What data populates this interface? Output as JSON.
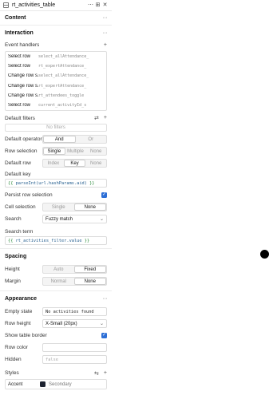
{
  "header": {
    "title": "rt_activities_table"
  },
  "sections": {
    "content": "Content",
    "interaction": "Interaction",
    "spacing": "Spacing",
    "appearance": "Appearance"
  },
  "event_handlers": {
    "label": "Event handlers",
    "rows": [
      {
        "event": "Select row",
        "action": "select_allAttendance_"
      },
      {
        "event": "Select row",
        "action": "rt_expertAttendance_"
      },
      {
        "event": "Change row s...",
        "action": "select_allAttendance_"
      },
      {
        "event": "Change row s...",
        "action": "rt_expertAttendance_"
      },
      {
        "event": "Change row s...",
        "action": "rt_attendees_toggle"
      },
      {
        "event": "Select row",
        "action": "current_activityId_s"
      }
    ]
  },
  "default_filters": {
    "label": "Default filters",
    "empty": "No filters"
  },
  "default_operator": {
    "label": "Default operator",
    "options": [
      "And",
      "Or"
    ],
    "selected": "And"
  },
  "row_selection": {
    "label": "Row selection",
    "options": [
      "Single",
      "Multiple",
      "None"
    ],
    "selected": "Single"
  },
  "default_row": {
    "label": "Default row",
    "options": [
      "Index",
      "Key",
      "None"
    ],
    "selected": "Key"
  },
  "default_key": {
    "label": "Default key",
    "open": "{{",
    "expr": "parseInt(url.hashParams.aid)",
    "close": "}}"
  },
  "persist_row_selection": {
    "label": "Persist row selection",
    "checked": true
  },
  "cell_selection": {
    "label": "Cell selection",
    "options": [
      "Single",
      "None"
    ],
    "selected": "None"
  },
  "search": {
    "label": "Search",
    "value": "Fuzzy match"
  },
  "search_term": {
    "label": "Search term",
    "open": "{{",
    "expr": "rt_activities_filter.value",
    "close": "}}"
  },
  "height": {
    "label": "Height",
    "options": [
      "Auto",
      "Fixed"
    ],
    "selected": "Fixed"
  },
  "margin": {
    "label": "Margin",
    "options": [
      "Normal",
      "None"
    ],
    "selected": "None"
  },
  "empty_state": {
    "label": "Empty state",
    "value": "No activities found"
  },
  "row_height": {
    "label": "Row height",
    "value": "X-Small (20px)"
  },
  "show_table_border": {
    "label": "Show table border",
    "checked": true
  },
  "row_color": {
    "label": "Row color",
    "value": ""
  },
  "hidden": {
    "label": "Hidden",
    "value": "false"
  },
  "styles": {
    "label": "Styles",
    "accent_label": "Accent",
    "accent_value": "Secondary",
    "accent_color": "#1c2230"
  },
  "colors": {
    "checkbox": "#2d6fd6"
  },
  "icons": {
    "component": "component-icon",
    "more": "more-horizontal-icon",
    "pin": "pin-icon",
    "close": "close-icon",
    "filter_link": "link-icon",
    "add": "plus-icon",
    "chevron": "chevron-down-icon",
    "reset": "reset-icon",
    "check": "checkmark-icon",
    "cursor": "cursor-dot-icon"
  }
}
